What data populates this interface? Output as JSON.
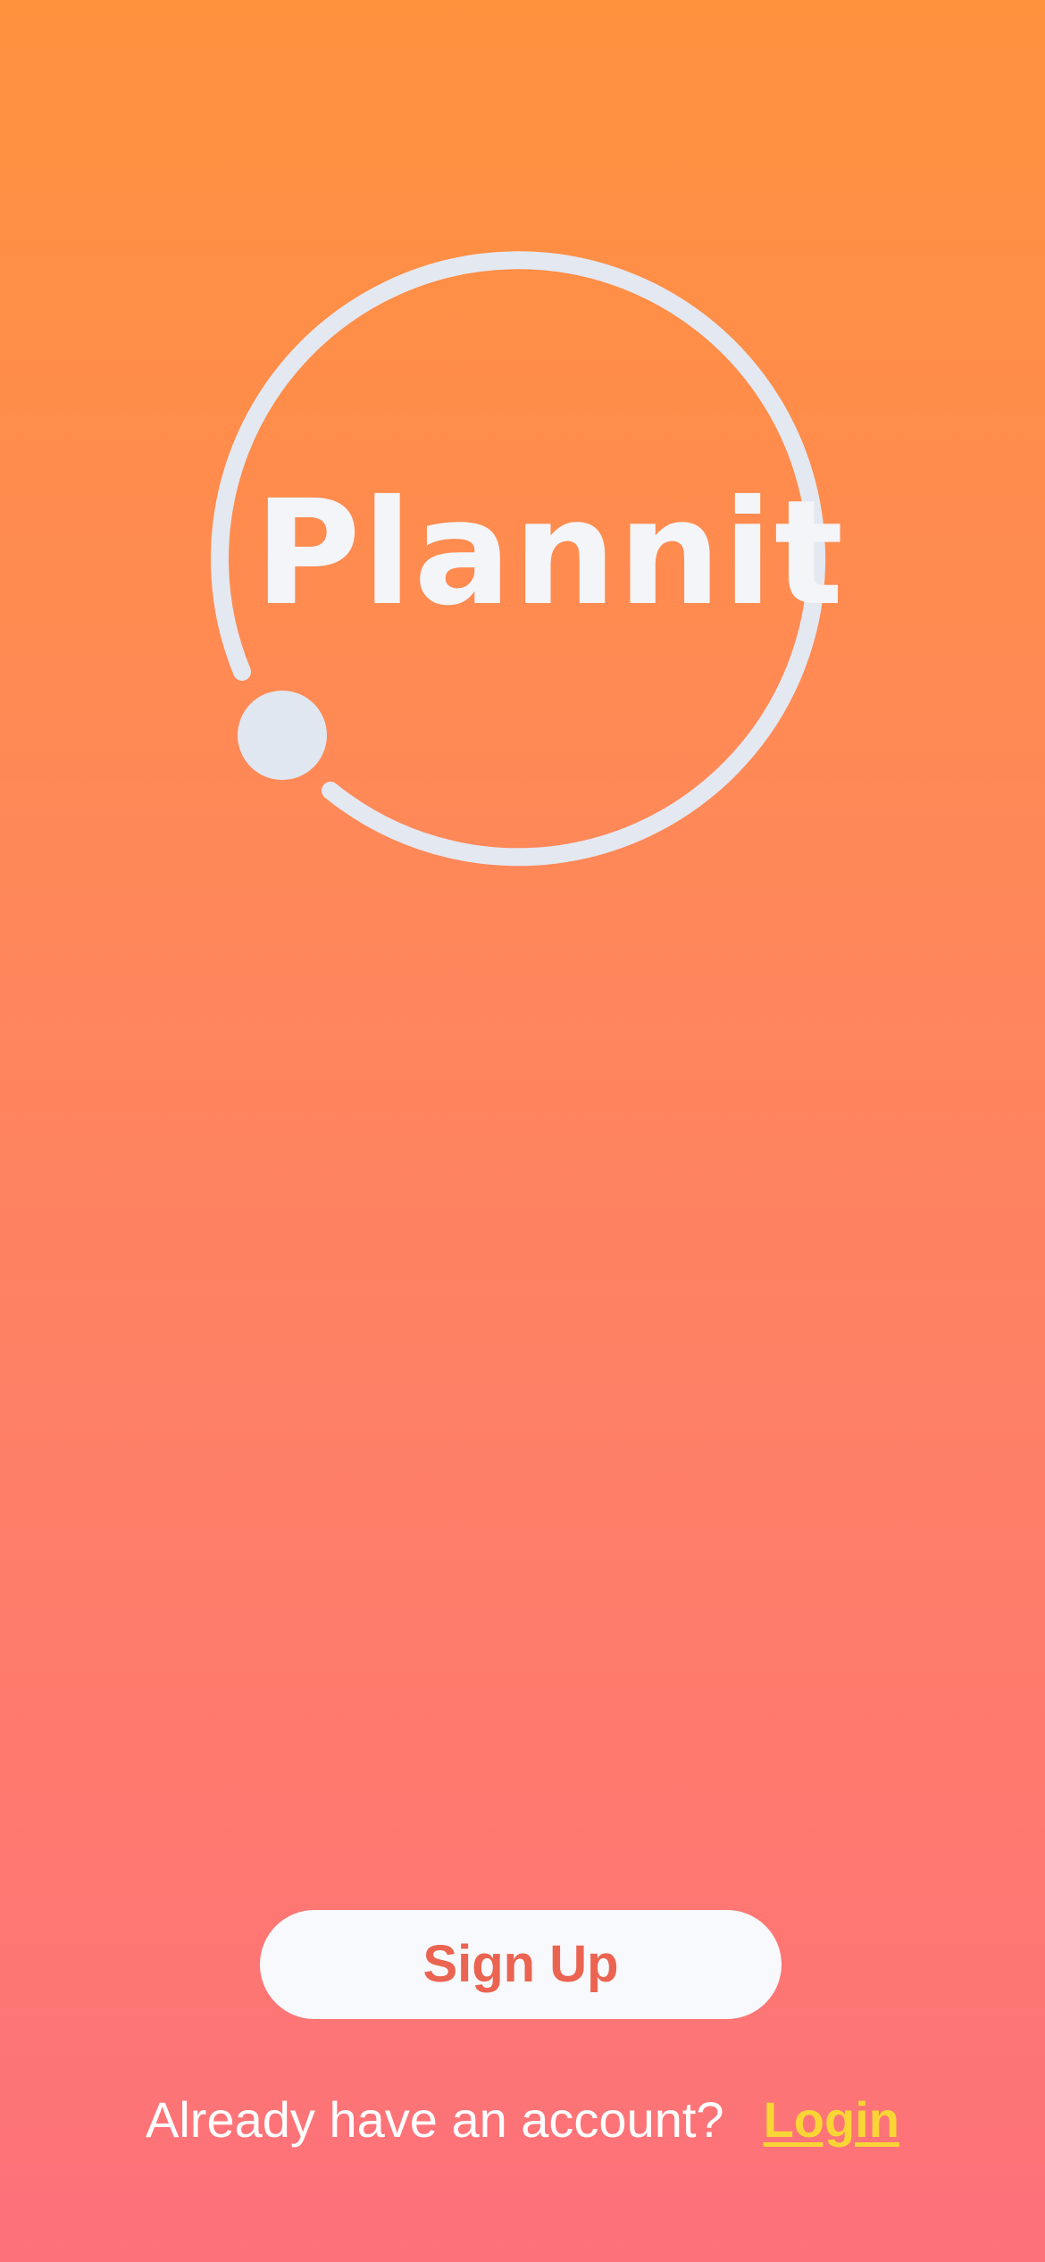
{
  "app": {
    "name": "Plannit",
    "logo_icon": "orbit-ring-icon"
  },
  "actions": {
    "signup_label": "Sign Up",
    "login_prompt": "Already have an account?",
    "login_label": "Login"
  },
  "colors": {
    "gradient_top": "#ff913d",
    "gradient_bottom": "#fd717b",
    "logo_color": "#e4e8f1",
    "signup_text": "#ea6451",
    "login_link": "#f9d535"
  }
}
